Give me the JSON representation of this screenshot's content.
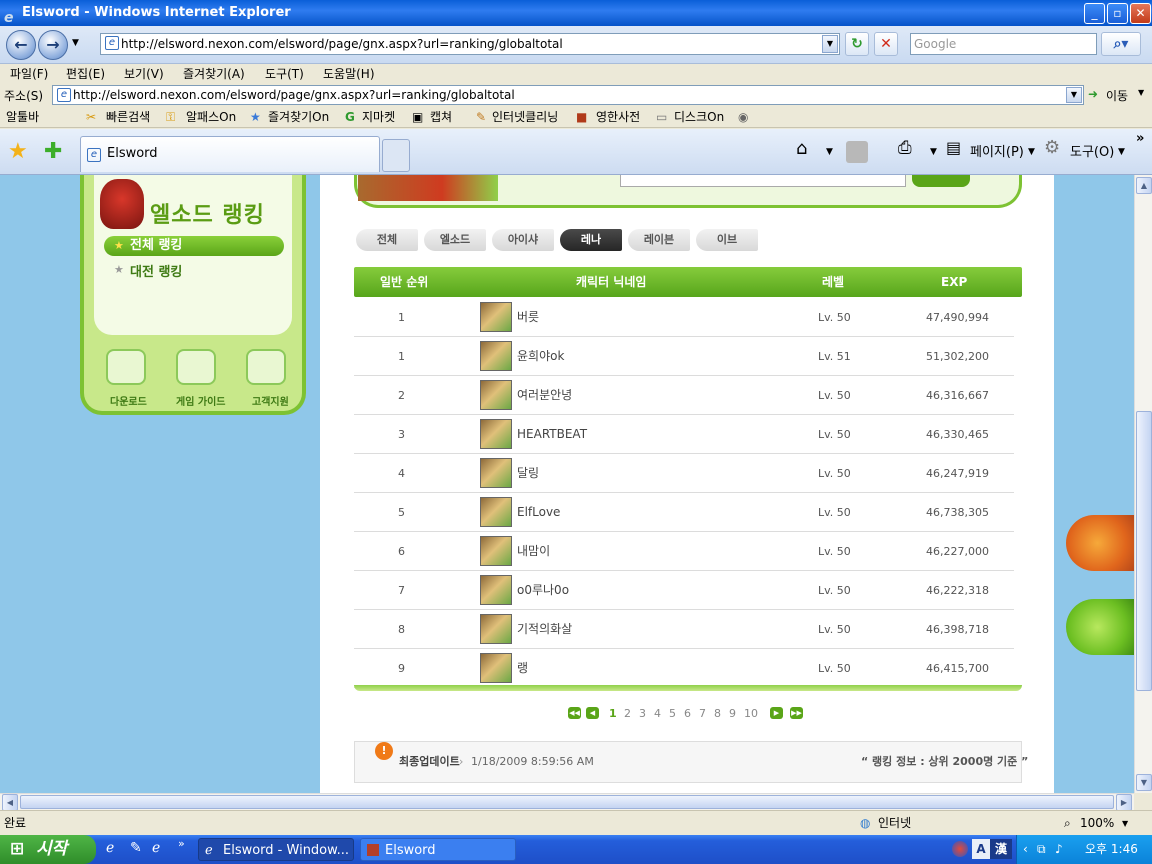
{
  "window": {
    "title": "Elsword - Windows Internet Explorer",
    "min": "_",
    "max": "▫",
    "close": "✕"
  },
  "nav": {
    "back": "←",
    "forward": "→",
    "url": "http://elsword.nexon.com/elsword/page/gnx.aspx?url=ranking/globaltotal",
    "search_placeholder": "Google",
    "refresh": "↻",
    "stop": "✕"
  },
  "menubar": [
    "파일(F)",
    "편집(E)",
    "보기(V)",
    "즐겨찾기(A)",
    "도구(T)",
    "도움말(H)"
  ],
  "addressbar": {
    "label": "주소(S)",
    "url": "http://elsword.nexon.com/elsword/page/gnx.aspx?url=ranking/globaltotal",
    "go": "이동"
  },
  "links": [
    "알툴바",
    "빠른검색",
    "알패스On",
    "즐겨찾기On",
    "지마켓",
    "캡쳐",
    "인터넷클리닝",
    "영한사전",
    "디스크On"
  ],
  "tab": {
    "label": "Elsword"
  },
  "commands": {
    "page": "페이지(P)",
    "tools": "도구(O)"
  },
  "side": {
    "title": "엘소드 랭킹",
    "menu_total": "전체 랭킹",
    "menu_pvp": "대전 랭킹",
    "download": "다운로드",
    "guide": "게임 가이드",
    "support": "고객지원"
  },
  "char_tabs": [
    "전체",
    "엘소드",
    "아이샤",
    "레나",
    "레이븐",
    "이브"
  ],
  "active_tab": 3,
  "table": {
    "headers": [
      "일반 순위",
      "캐릭터 닉네임",
      "레벨",
      "EXP"
    ],
    "rows": [
      {
        "rank": "1",
        "name": "버릇",
        "level": "Lv. 50",
        "exp": "47,490,994"
      },
      {
        "rank": "1",
        "name": "윤희야ok",
        "level": "Lv. 51",
        "exp": "51,302,200"
      },
      {
        "rank": "2",
        "name": "여러분안녕",
        "level": "Lv. 50",
        "exp": "46,316,667"
      },
      {
        "rank": "3",
        "name": "HEARTBEAT",
        "level": "Lv. 50",
        "exp": "46,330,465"
      },
      {
        "rank": "4",
        "name": "달링",
        "level": "Lv. 50",
        "exp": "46,247,919"
      },
      {
        "rank": "5",
        "name": "ElfLove",
        "level": "Lv. 50",
        "exp": "46,738,305"
      },
      {
        "rank": "6",
        "name": "내맘이",
        "level": "Lv. 50",
        "exp": "46,227,000"
      },
      {
        "rank": "7",
        "name": "o0루나0o",
        "level": "Lv. 50",
        "exp": "46,222,318"
      },
      {
        "rank": "8",
        "name": "기적의화살",
        "level": "Lv. 50",
        "exp": "46,398,718"
      },
      {
        "rank": "9",
        "name": "랭",
        "level": "Lv. 50",
        "exp": "46,415,700"
      }
    ]
  },
  "pager": {
    "pages": [
      "1",
      "2",
      "3",
      "4",
      "5",
      "6",
      "7",
      "8",
      "9",
      "10"
    ],
    "current": "1"
  },
  "info": {
    "label": "최종업데이트",
    "time": "1/18/2009 8:59:56 AM",
    "note": "“ 랭킹 정보 : 상위 2000명 기준 ”"
  },
  "status": {
    "text": "완료",
    "zone": "인터넷",
    "zoom": "100%"
  },
  "taskbar": {
    "start": "시작",
    "items": [
      "Elsword - Window...",
      "Elsword"
    ],
    "time": "오후 1:46"
  }
}
